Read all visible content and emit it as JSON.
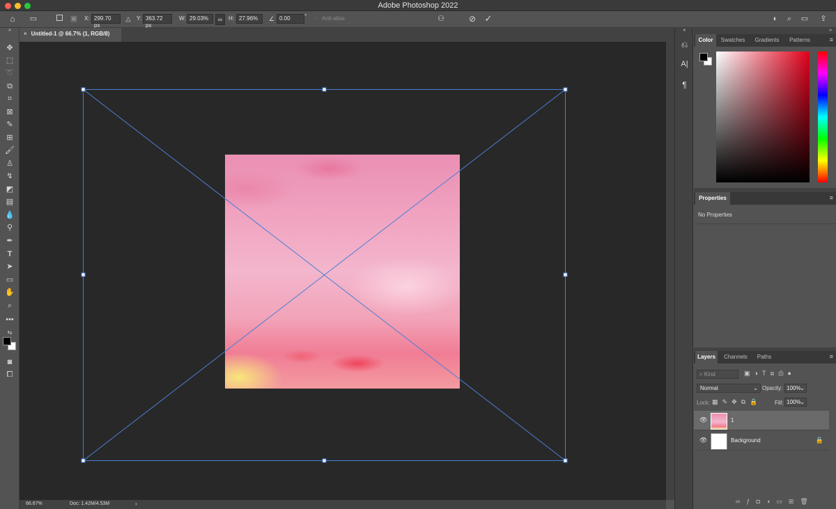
{
  "window": {
    "title": "Adobe Photoshop 2022"
  },
  "options_bar": {
    "x_label": "X:",
    "x_value": "299.70 px",
    "y_label": "Y:",
    "y_value": "363.72 px",
    "w_label": "W:",
    "w_value": "29.03%",
    "h_label": "H:",
    "h_value": "27.96%",
    "angle_value": "0.00",
    "angle_unit": "°",
    "antialias_label": "Anti-alias"
  },
  "document": {
    "tab_title": "Untitled-1 @ 66.7% (1, RGB/8)",
    "close": "×"
  },
  "status": {
    "zoom": "66.67%",
    "doc_info": "Doc: 1.42M/4.53M",
    "arrow": "›"
  },
  "color_panel": {
    "tabs": [
      "Color",
      "Swatches",
      "Gradients",
      "Patterns"
    ],
    "active": "Color"
  },
  "properties_panel": {
    "tab": "Properties",
    "text": "No Properties"
  },
  "layers_panel": {
    "tabs": [
      "Layers",
      "Channels",
      "Paths"
    ],
    "filter_placeholder": "Kind",
    "blend_mode": "Normal",
    "opacity_label": "Opacity:",
    "opacity_value": "100%",
    "lock_label": "Lock:",
    "fill_label": "Fill:",
    "fill_value": "100%",
    "layers": [
      {
        "name": "1",
        "selected": true
      },
      {
        "name": "Background",
        "selected": false
      }
    ]
  },
  "colors": {
    "accent_transform": "#4a7fd4",
    "selected_layer": "#6a6a6a"
  }
}
